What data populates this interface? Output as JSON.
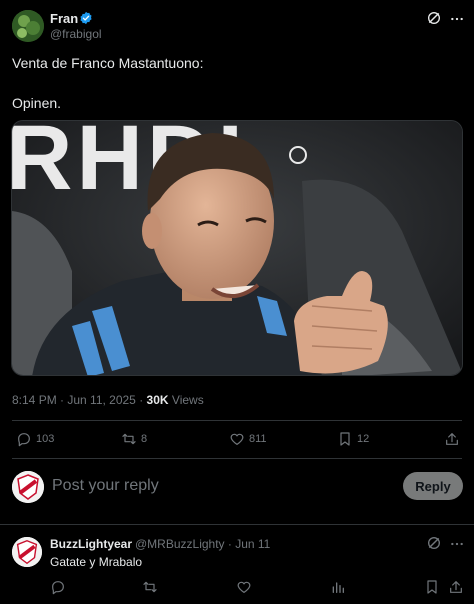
{
  "post": {
    "author_name": "Fran",
    "author_handle": "@frabigol",
    "text_line1": "Venta de Franco Mastantuono:",
    "text_line2": "Opinen.",
    "photo_banner_text": "RHDL",
    "timestamp": "8:14 PM · Jun 11, 2025",
    "separator": "·",
    "views_count": "30K",
    "views_label": "Views",
    "replies": "103",
    "reposts": "8",
    "likes": "811",
    "bookmarks": "12"
  },
  "reply_box": {
    "placeholder": "Post your reply",
    "button_label": "Reply"
  },
  "comment": {
    "author_name": "BuzzLightyear",
    "author_handle": "@MRBuzzLighty · Jun 11",
    "text": "Gatate y Mrabalo"
  },
  "colors": {
    "background": "#000000",
    "text": "#e7e9ea",
    "muted": "#71767b",
    "divider": "#2f3336",
    "verified": "#1d9bf0"
  },
  "icons": [
    "verified-badge-icon",
    "grok-icon",
    "more-icon",
    "reply-icon",
    "repost-icon",
    "like-icon",
    "bookmark-icon",
    "share-icon",
    "views-icon"
  ]
}
